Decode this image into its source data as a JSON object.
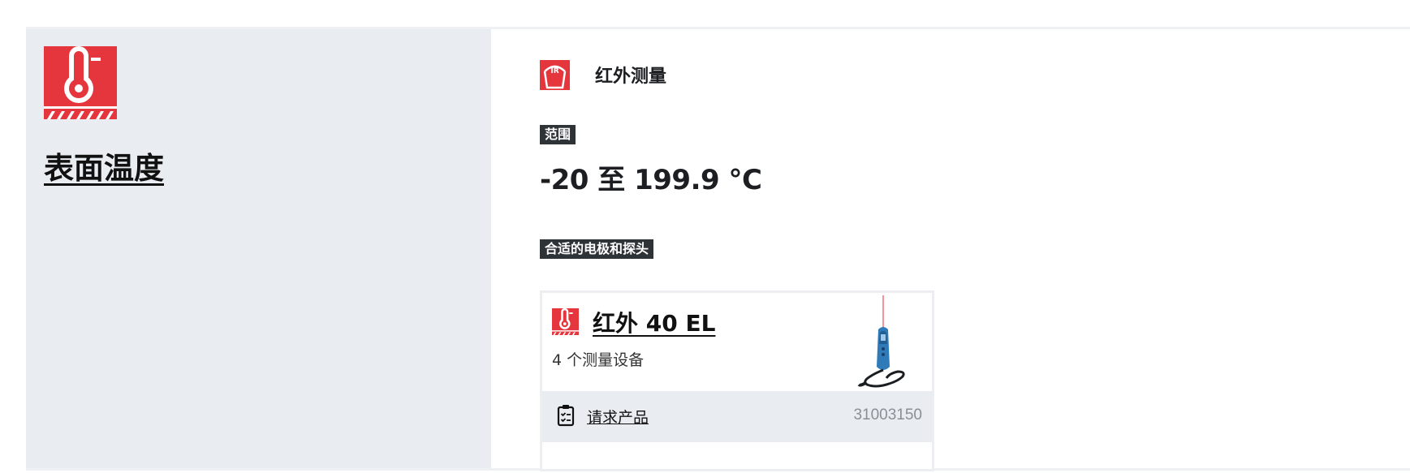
{
  "parameter": {
    "icon": "surface-thermometer-icon",
    "title": "表面温度"
  },
  "method": {
    "icon": "infrared-icon",
    "icon_text": "IR",
    "label": "红外测量"
  },
  "range": {
    "tag": "范围",
    "value": "-20 至 199.9 °C"
  },
  "probes": {
    "tag": "合适的电极和探头"
  },
  "product": {
    "icon": "surface-thermometer-icon",
    "title": "红外 40 EL",
    "subtitle": "4 个测量设备",
    "image": "infrared-thermometer-image",
    "request_icon": "clipboard-checklist-icon",
    "request_label": "请求产品",
    "article_number": "31003150"
  },
  "colors": {
    "brand_red": "#e5363d",
    "tag_bg": "#2e3338",
    "panel_bg": "#e9edf2",
    "device_blue": "#2f7ab8"
  }
}
